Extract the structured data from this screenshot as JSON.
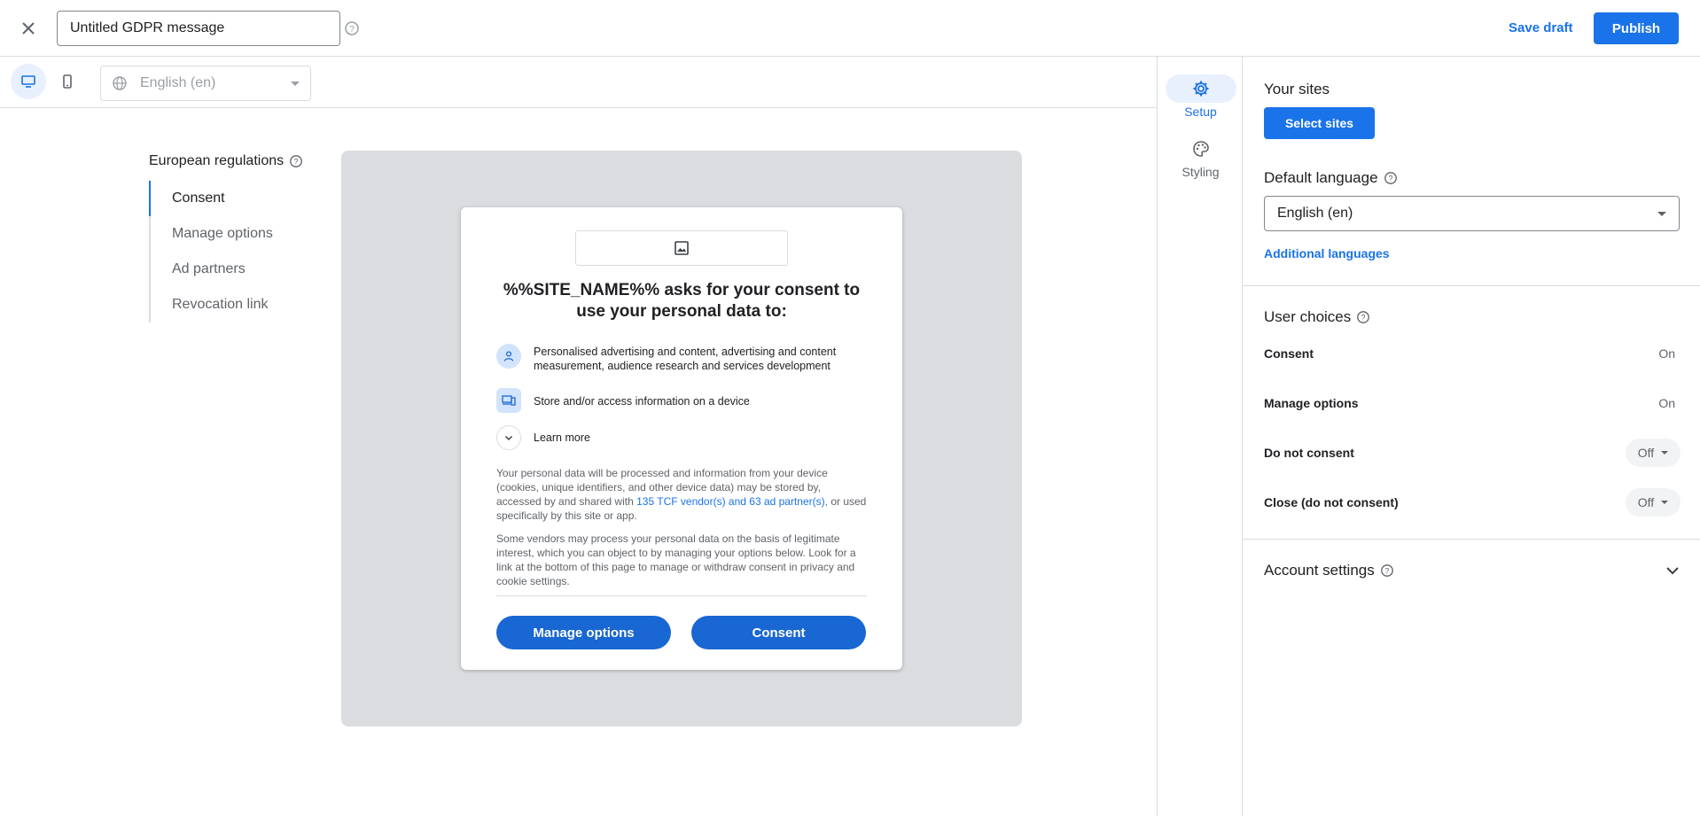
{
  "header": {
    "title_value": "Untitled GDPR message",
    "save_draft": "Save draft",
    "publish": "Publish",
    "icons": {
      "close": "close-icon",
      "help": "help-icon"
    }
  },
  "preview_toolbar": {
    "devices": [
      {
        "name": "desktop",
        "icon": "desktop-icon",
        "active": true
      },
      {
        "name": "mobile",
        "icon": "mobile-icon",
        "active": false
      }
    ],
    "language": "English (en)"
  },
  "regulations": {
    "title": "European regulations",
    "items": [
      {
        "label": "Consent",
        "active": true
      },
      {
        "label": "Manage options",
        "active": false
      },
      {
        "label": "Ad partners",
        "active": false
      },
      {
        "label": "Revocation link",
        "active": false
      }
    ]
  },
  "dialog": {
    "heading": "%%SITE_NAME%% asks for your consent to use your personal data to:",
    "purposes": [
      {
        "icon": "person-icon",
        "text": "Personalised advertising and content, advertising and content measurement, audience research and services development"
      },
      {
        "icon": "devices-icon",
        "text": "Store and/or access information on a device"
      }
    ],
    "learn_more": "Learn more",
    "para1_before": "Your personal data will be processed and information from your device (cookies, unique identifiers, and other device data) may be stored by, accessed by and shared with ",
    "para1_link": "135 TCF vendor(s) and 63 ad partner(s)",
    "para1_after": ", or used specifically by this site or app.",
    "para2": "Some vendors may process your personal data on the basis of legitimate interest, which you can object to by managing your options below. Look for a link at the bottom of this page to manage or withdraw consent in privacy and cookie settings.",
    "manage_options": "Manage options",
    "consent": "Consent"
  },
  "rail": {
    "items": [
      {
        "label": "Setup",
        "icon": "gear-icon",
        "active": true
      },
      {
        "label": "Styling",
        "icon": "palette-icon",
        "active": false
      }
    ]
  },
  "panel": {
    "your_sites": "Your sites",
    "select_sites": "Select sites",
    "default_language": "Default language",
    "default_language_value": "English (en)",
    "additional_languages": "Additional languages",
    "user_choices": "User choices",
    "choices": [
      {
        "label": "Consent",
        "value": "On",
        "dropdown": false
      },
      {
        "label": "Manage options",
        "value": "On",
        "dropdown": false
      },
      {
        "label": "Do not consent",
        "value": "Off",
        "dropdown": true
      },
      {
        "label": "Close (do not consent)",
        "value": "Off",
        "dropdown": true
      }
    ],
    "account_settings": "Account settings"
  },
  "colors": {
    "accent": "#1a73e8",
    "dialog_button": "#1967d2",
    "preview_bg": "#dadce0"
  }
}
